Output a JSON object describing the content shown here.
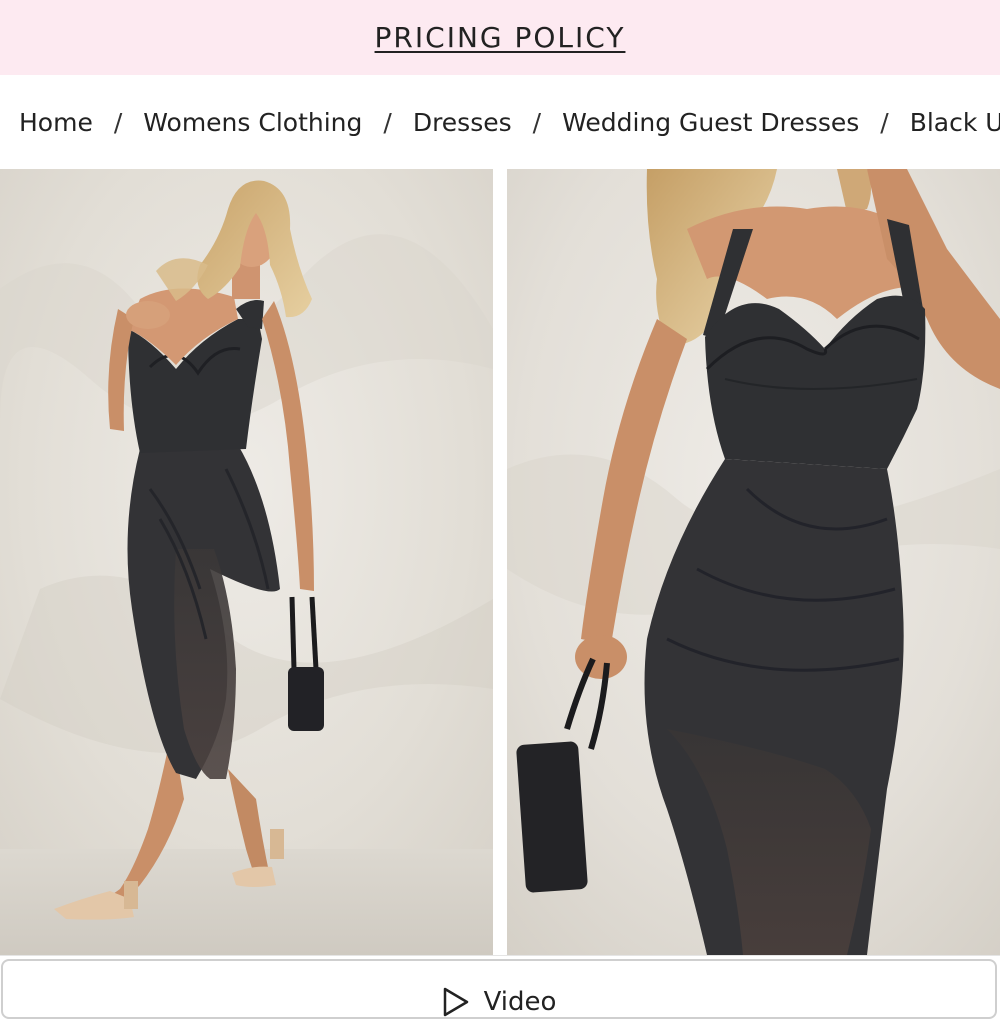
{
  "promo": {
    "label": "PRICING POLICY"
  },
  "breadcrumb": {
    "items": [
      "Home",
      "Womens Clothing",
      "Dresses",
      "Wedding Guest Dresses",
      "Black Un..."
    ],
    "separator": "/"
  },
  "gallery": {
    "images": [
      {
        "name": "product-image-full-length"
      },
      {
        "name": "product-image-close-up"
      }
    ]
  },
  "video": {
    "label": "Video",
    "icon": "play-icon"
  },
  "colors": {
    "promo_background": "#fdeaf1",
    "dress": "#2f3033",
    "wall": "#e4e0d9"
  }
}
